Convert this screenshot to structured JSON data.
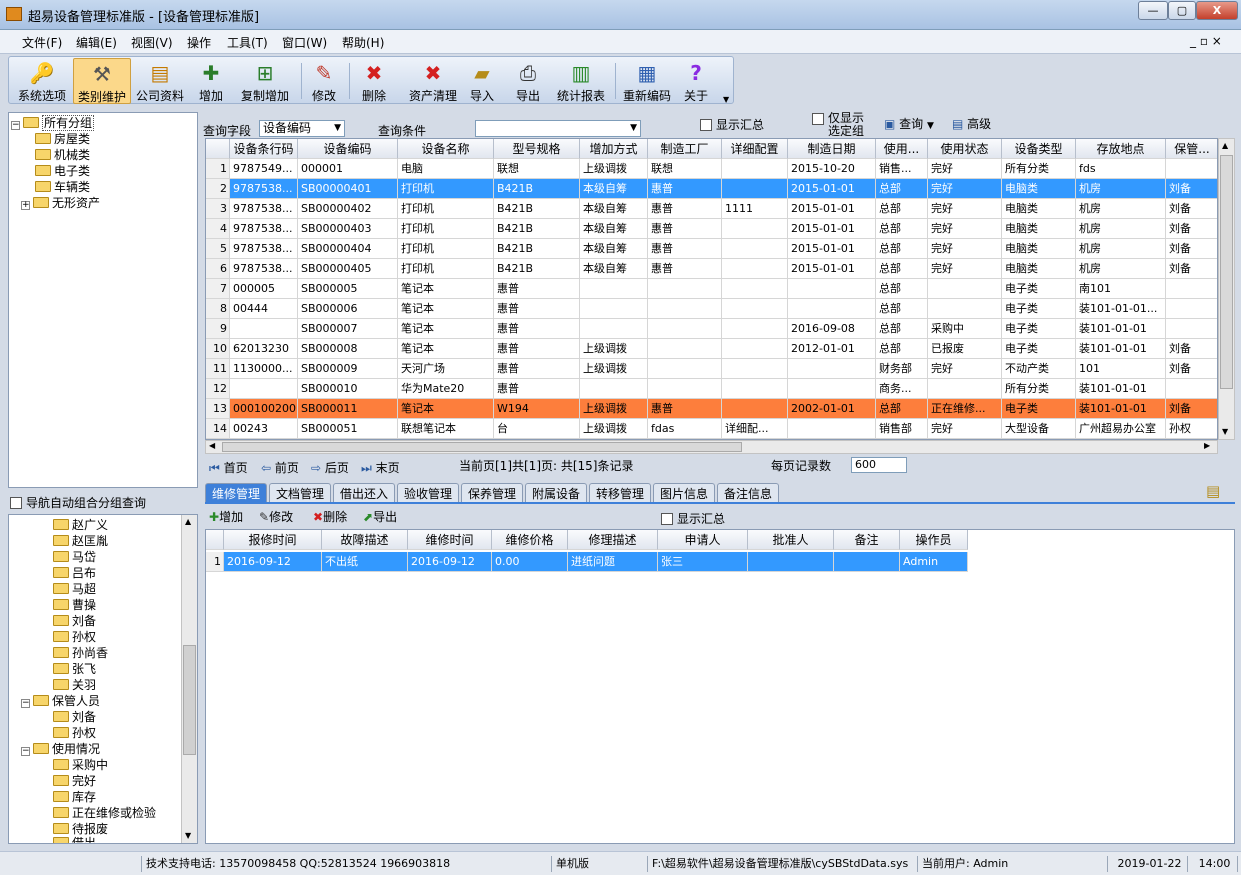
{
  "window": {
    "title": "超易设备管理标准版 - [设备管理标准版]",
    "min": "▭",
    "max": "▣",
    "close": "X"
  },
  "menu": {
    "items": [
      "文件(F)",
      "编辑(E)",
      "视图(V)",
      "操作",
      "工具(T)",
      "窗口(W)",
      "帮助(H)"
    ],
    "right": "_ ▫ ×"
  },
  "toolbar": {
    "items": [
      {
        "label": "系统选项",
        "icon": "key-icon",
        "glyph": "🔑"
      },
      {
        "label": "类别维护",
        "icon": "tools-icon",
        "glyph": "⚒"
      },
      {
        "label": "公司资料",
        "icon": "company-icon",
        "glyph": "🏢"
      },
      {
        "label": "增加",
        "icon": "add-user-icon",
        "glyph": "👤"
      },
      {
        "label": "复制增加",
        "icon": "copy-add-icon",
        "glyph": "➕"
      },
      {
        "label": "修改",
        "icon": "pencil-icon",
        "glyph": "✏"
      },
      {
        "label": "删除",
        "icon": "delete-icon",
        "glyph": "✖"
      },
      {
        "label": "资产清理",
        "icon": "clear-icon",
        "glyph": "✖"
      },
      {
        "label": "导入",
        "icon": "import-icon",
        "glyph": "📂"
      },
      {
        "label": "导出",
        "icon": "export-icon",
        "glyph": "🖨"
      },
      {
        "label": "统计报表",
        "icon": "chart-icon",
        "glyph": "📊"
      },
      {
        "label": "重新编码",
        "icon": "recode-icon",
        "glyph": "🗓"
      },
      {
        "label": "关于",
        "icon": "help-icon",
        "glyph": "?"
      }
    ]
  },
  "tree_top": [
    {
      "label": "所有分组",
      "level": 0,
      "pm": "−"
    },
    {
      "label": "房屋类",
      "level": 1
    },
    {
      "label": "机械类",
      "level": 1
    },
    {
      "label": "电子类",
      "level": 1
    },
    {
      "label": "车辆类",
      "level": 1
    },
    {
      "label": "无形资产",
      "level": 1,
      "pm": "+"
    }
  ],
  "nav_query": {
    "label": "导航自动组合分组查询"
  },
  "tree_bottom": [
    {
      "label": "赵广义",
      "level": 2
    },
    {
      "label": "赵匡胤",
      "level": 2
    },
    {
      "label": "马岱",
      "level": 2
    },
    {
      "label": "吕布",
      "level": 2
    },
    {
      "label": "马超",
      "level": 2
    },
    {
      "label": "曹操",
      "level": 2
    },
    {
      "label": "刘备",
      "level": 2
    },
    {
      "label": "孙权",
      "level": 2
    },
    {
      "label": "孙尚香",
      "level": 2
    },
    {
      "label": "张飞",
      "level": 2
    },
    {
      "label": "关羽",
      "level": 2
    },
    {
      "label": "保管人员",
      "level": 1,
      "pm": "−"
    },
    {
      "label": "刘备",
      "level": 2
    },
    {
      "label": "孙权",
      "level": 2
    },
    {
      "label": "使用情况",
      "level": 1,
      "pm": "−"
    },
    {
      "label": "采购中",
      "level": 2
    },
    {
      "label": "完好",
      "level": 2
    },
    {
      "label": "库存",
      "level": 2
    },
    {
      "label": "正在维修或检验",
      "level": 2
    },
    {
      "label": "待报废",
      "level": 2
    },
    {
      "label": "借出",
      "level": 2
    }
  ],
  "query": {
    "field_label": "查询字段",
    "field_value": "设备编码",
    "cond_label": "查询条件",
    "show_sum": "显示汇总",
    "only_selected": "仅显示选定组",
    "search": "查询",
    "advanced": "高级"
  },
  "grid": {
    "columns": [
      "设备条行码",
      "设备编码",
      "设备名称",
      "型号规格",
      "增加方式",
      "制造工厂",
      "详细配置",
      "制造日期",
      "使用...",
      "使用状态",
      "设备类型",
      "存放地点",
      "保管..."
    ],
    "rows": [
      [
        "9787549...",
        "000001",
        "电脑",
        "联想",
        "上级调拨",
        "联想",
        "",
        "2015-10-20",
        "销售...",
        "完好",
        "所有分类",
        "fds",
        ""
      ],
      [
        "9787538...",
        "SB00000401",
        "打印机",
        "B421B",
        "本级自筹",
        "惠普",
        "",
        "2015-01-01",
        "总部",
        "完好",
        "电脑类",
        "机房",
        "刘备"
      ],
      [
        "9787538...",
        "SB00000402",
        "打印机",
        "B421B",
        "本级自筹",
        "惠普",
        "1111",
        "2015-01-01",
        "总部",
        "完好",
        "电脑类",
        "机房",
        "刘备"
      ],
      [
        "9787538...",
        "SB00000403",
        "打印机",
        "B421B",
        "本级自筹",
        "惠普",
        "",
        "2015-01-01",
        "总部",
        "完好",
        "电脑类",
        "机房",
        "刘备"
      ],
      [
        "9787538...",
        "SB00000404",
        "打印机",
        "B421B",
        "本级自筹",
        "惠普",
        "",
        "2015-01-01",
        "总部",
        "完好",
        "电脑类",
        "机房",
        "刘备"
      ],
      [
        "9787538...",
        "SB00000405",
        "打印机",
        "B421B",
        "本级自筹",
        "惠普",
        "",
        "2015-01-01",
        "总部",
        "完好",
        "电脑类",
        "机房",
        "刘备"
      ],
      [
        "000005",
        "SB000005",
        "笔记本",
        "惠普",
        "",
        "",
        "",
        "",
        "总部",
        "",
        "电子类",
        "南101",
        ""
      ],
      [
        "00444",
        "SB000006",
        "笔记本",
        "惠普",
        "",
        "",
        "",
        "",
        "总部",
        "",
        "电子类",
        "装101-01-01...",
        ""
      ],
      [
        "",
        "SB000007",
        "笔记本",
        "惠普",
        "",
        "",
        "",
        "2016-09-08",
        "总部",
        "采购中",
        "电子类",
        "装101-01-01",
        ""
      ],
      [
        "62013230",
        "SB000008",
        "笔记本",
        "惠普",
        "上级调拨",
        "",
        "",
        "2012-01-01",
        "总部",
        "已报废",
        "电子类",
        "装101-01-01",
        "刘备"
      ],
      [
        "1130000...",
        "SB000009",
        "天河广场",
        "惠普",
        "上级调拨",
        "",
        "",
        "",
        "财务部",
        "完好",
        "不动产类",
        "101",
        "刘备"
      ],
      [
        "",
        "SB000010",
        "华为Mate20",
        "惠普",
        "",
        "",
        "",
        "",
        "商务...",
        "",
        "所有分类",
        "装101-01-01",
        ""
      ],
      [
        "000100200",
        "SB000011",
        "笔记本",
        "W194",
        "上级调拨",
        "惠普",
        "",
        "2002-01-01",
        "总部",
        "正在维修...",
        "电子类",
        "装101-01-01",
        "刘备"
      ],
      [
        "00243",
        "SB000051",
        "联想笔记本",
        "台",
        "上级调拨",
        "fdas",
        "详细配...",
        "",
        "销售部",
        "完好",
        "大型设备",
        "广州超易办公室",
        "孙权"
      ]
    ],
    "row_numbers": [
      "1",
      "2",
      "3",
      "4",
      "5",
      "6",
      "7",
      "8",
      "9",
      "10",
      "11",
      "12",
      "13",
      "14"
    ]
  },
  "pager": {
    "first": "首页",
    "prev": "前页",
    "next": "后页",
    "last": "末页",
    "info": "当前页[1]共[1]页: 共[15]条记录",
    "per_page_label": "每页记录数",
    "per_page": "600"
  },
  "tabs": [
    "维修管理",
    "文档管理",
    "借出还入",
    "验收管理",
    "保养管理",
    "附属设备",
    "转移管理",
    "图片信息",
    "备注信息"
  ],
  "sub_toolbar": {
    "add": "增加",
    "edit": "修改",
    "delete": "删除",
    "export": "导出",
    "show_sum": "显示汇总"
  },
  "grid2": {
    "columns": [
      "报修时间",
      "故障描述",
      "维修时间",
      "维修价格",
      "修理描述",
      "申请人",
      "批准人",
      "备注",
      "操作员"
    ],
    "rows": [
      [
        "2016-09-12",
        "不出纸",
        "2016-09-12",
        "0.00",
        "进纸问题",
        "张三",
        "",
        "",
        "Admin"
      ]
    ],
    "row_numbers": [
      "1"
    ]
  },
  "status": {
    "support": "技术支持电话: 13570098458 QQ:52813524 1966903818",
    "edition": "单机版",
    "path": "F:\\超易软件\\超易设备管理标准版\\cySBStdData.sys",
    "user": "当前用户: Admin",
    "date": "2019-01-22",
    "time": "14:00"
  },
  "colors": {
    "selected_row": "#3399ff",
    "highlight_row": "#fd7e3c",
    "active_tab": "#3e80d9"
  }
}
